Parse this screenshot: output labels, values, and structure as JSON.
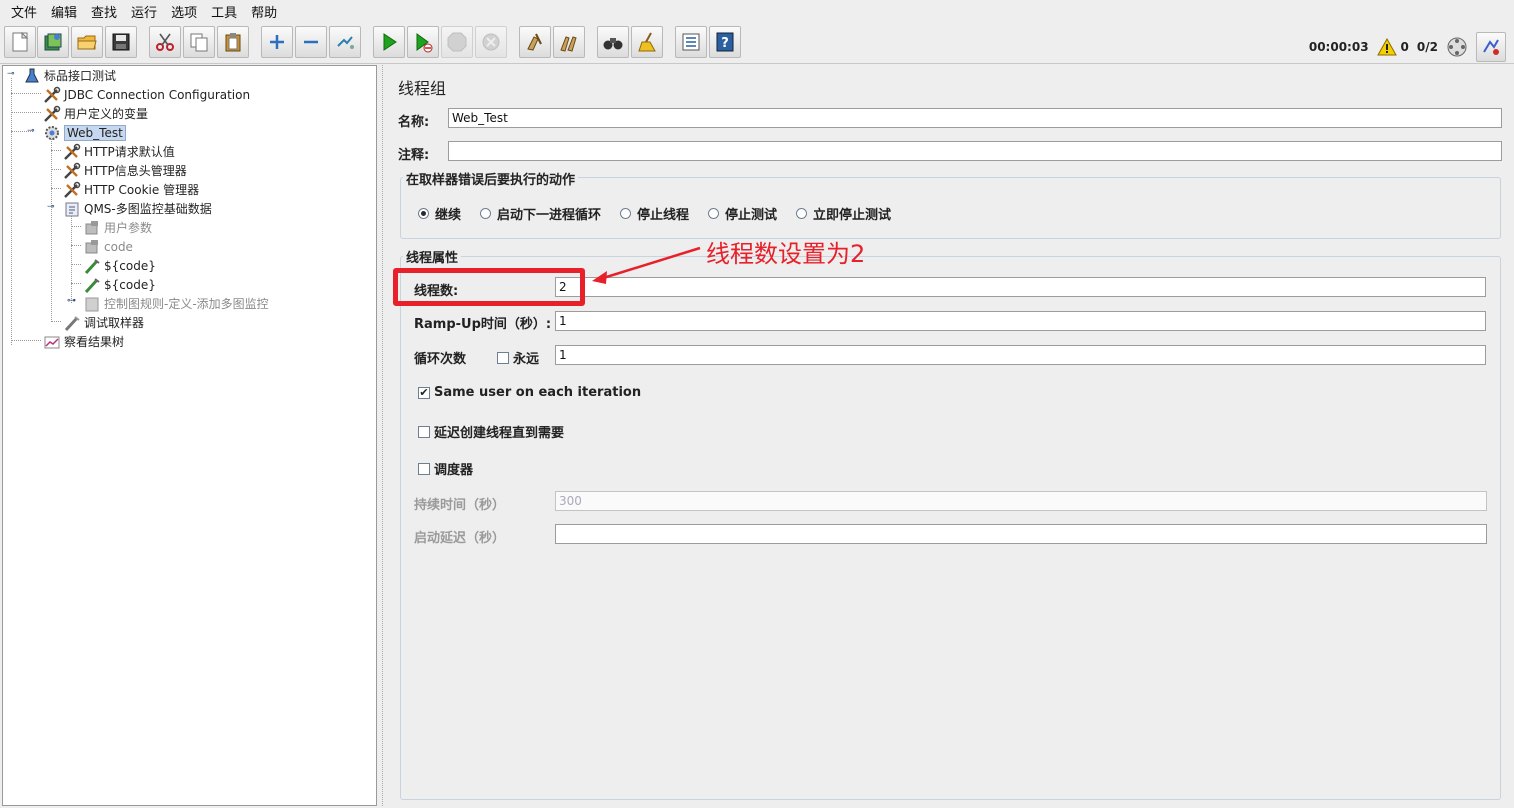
{
  "menu": [
    "文件",
    "编辑",
    "查找",
    "运行",
    "选项",
    "工具",
    "帮助"
  ],
  "toolbar": {
    "buttons": [
      {
        "id": "new",
        "icon": "new-file-icon"
      },
      {
        "id": "templates",
        "icon": "templates-icon"
      },
      {
        "id": "open",
        "icon": "open-folder-icon"
      },
      {
        "id": "save",
        "icon": "save-icon"
      },
      {
        "id": "cut",
        "icon": "cut-icon"
      },
      {
        "id": "copy",
        "icon": "copy-icon"
      },
      {
        "id": "paste",
        "icon": "paste-icon"
      },
      {
        "id": "expand",
        "icon": "plus-icon"
      },
      {
        "id": "collapse",
        "icon": "minus-icon"
      },
      {
        "id": "toggle",
        "icon": "toggle-icon"
      },
      {
        "id": "start",
        "icon": "play-icon"
      },
      {
        "id": "start-no-pause",
        "icon": "play-no-pause-icon"
      },
      {
        "id": "stop",
        "icon": "stop-icon"
      },
      {
        "id": "shutdown",
        "icon": "shutdown-icon"
      },
      {
        "id": "clear",
        "icon": "clear-icon"
      },
      {
        "id": "clear-all",
        "icon": "clear-all-icon"
      },
      {
        "id": "search",
        "icon": "binoculars-icon"
      },
      {
        "id": "reset-search",
        "icon": "broom-icon"
      },
      {
        "id": "function-helper",
        "icon": "list-icon"
      },
      {
        "id": "help",
        "icon": "help-icon"
      }
    ],
    "status": {
      "elapsed": "00:00:03",
      "warnings": "0",
      "threads": "0/2"
    }
  },
  "tree": {
    "items": [
      {
        "label": "标品接口测试",
        "icon": "test-plan-icon"
      },
      {
        "label": "JDBC Connection Configuration",
        "icon": "config-tool-icon"
      },
      {
        "label": "用户定义的变量",
        "icon": "config-tool-icon"
      },
      {
        "label": "Web_Test",
        "icon": "thread-group-gear-icon"
      },
      {
        "label": "HTTP请求默认值",
        "icon": "config-tool-icon"
      },
      {
        "label": "HTTP信息头管理器",
        "icon": "config-tool-icon"
      },
      {
        "label": "HTTP Cookie 管理器",
        "icon": "config-tool-icon"
      },
      {
        "label": "QMS-多图监控基础数据",
        "icon": "transaction-controller-icon"
      },
      {
        "label": "用户参数",
        "icon": "user-params-icon"
      },
      {
        "label": "code",
        "icon": "user-params-icon"
      },
      {
        "label": "${code}",
        "icon": "pen-icon"
      },
      {
        "label": "${code}",
        "icon": "pen-icon"
      },
      {
        "label": "控制图规则-定义-添加多图监控",
        "icon": "controller-icon"
      },
      {
        "label": "调试取样器",
        "icon": "pen-icon"
      },
      {
        "label": "察看结果树",
        "icon": "listener-chart-icon"
      }
    ]
  },
  "main": {
    "title": "线程组",
    "name_label": "名称:",
    "name_value": "Web_Test",
    "comment_label": "注释:",
    "comment_value": "",
    "error_group": {
      "title": "在取样器错误后要执行的动作",
      "options": [
        "继续",
        "启动下一进程循环",
        "停止线程",
        "停止测试",
        "立即停止测试"
      ],
      "selected": "继续"
    },
    "thread_props": {
      "title": "线程属性",
      "threads_label": "线程数:",
      "threads_value": "2",
      "rampup_label": "Ramp-Up时间（秒）:",
      "rampup_value": "1",
      "loop_label": "循环次数",
      "forever_label": "永远",
      "forever_checked": false,
      "loop_value": "1",
      "same_user_label": "Same user on each iteration",
      "same_user_checked": true,
      "delay_label": "延迟创建线程直到需要",
      "delay_checked": false,
      "scheduler_label": "调度器",
      "scheduler_checked": false,
      "duration_label": "持续时间（秒）",
      "duration_value": "300",
      "startup_delay_label": "启动延迟（秒）",
      "startup_delay_value": ""
    }
  },
  "annotation": {
    "text": "线程数设置为2",
    "color": "#e8202a"
  }
}
